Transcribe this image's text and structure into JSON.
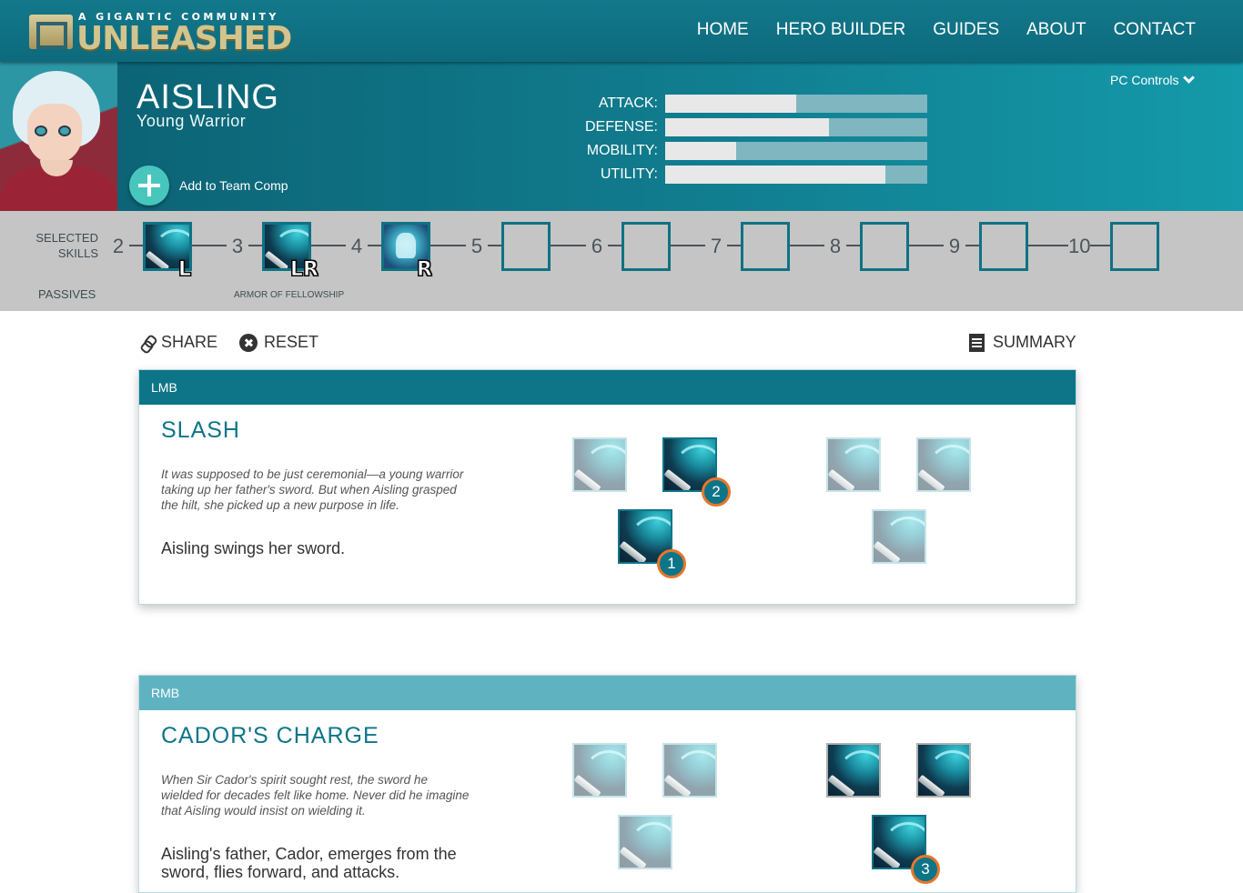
{
  "brand": {
    "tagline": "A GIGANTIC COMMUNITY",
    "name": "UNLEASHED"
  },
  "nav": {
    "items": [
      "HOME",
      "HERO BUILDER",
      "GUIDES",
      "ABOUT",
      "CONTACT"
    ]
  },
  "hero": {
    "name": "AISLING",
    "subtitle": "Young Warrior",
    "add_label": "Add to Team Comp",
    "controls_label": "PC Controls",
    "stats": [
      {
        "label": "ATTACK:",
        "value": 0.5
      },
      {
        "label": "DEFENSE:",
        "value": 0.625
      },
      {
        "label": "MOBILITY:",
        "value": 0.27
      },
      {
        "label": "UTILITY:",
        "value": 0.84
      }
    ]
  },
  "timeline": {
    "selected_label_1": "SELECTED",
    "selected_label_2": "SKILLS",
    "passives_label": "PASSIVES",
    "levels": [
      "2",
      "3",
      "4",
      "5",
      "6",
      "7",
      "8",
      "9",
      "10"
    ],
    "slots": [
      {
        "level": "2",
        "icon": "sword-slash-icon",
        "badge": "L"
      },
      {
        "level": "3",
        "icon": "sword-slash-icon",
        "badge": "LR"
      },
      {
        "level": "4",
        "icon": "armor-icon",
        "badge": "R"
      },
      {
        "level": "5",
        "icon": "",
        "badge": ""
      },
      {
        "level": "6",
        "icon": "",
        "badge": ""
      },
      {
        "level": "7",
        "icon": "",
        "badge": ""
      },
      {
        "level": "8",
        "icon": "",
        "badge": ""
      },
      {
        "level": "9",
        "icon": "",
        "badge": ""
      },
      {
        "level": "10",
        "icon": "",
        "badge": ""
      }
    ],
    "passive_name": "ARMOR OF FELLOWSHIP"
  },
  "toolbar": {
    "share": "SHARE",
    "reset": "RESET",
    "summary": "SUMMARY"
  },
  "skills": [
    {
      "key": "LMB",
      "title": "SLASH",
      "flavor": "It was supposed to be just ceremonial—a young warrior taking up her father's sword. But when Aisling grasped the hilt, she picked up a new purpose in life.",
      "description": "Aisling swings her sword.",
      "upgrades": [
        {
          "state": "dim",
          "order": ""
        },
        {
          "state": "selected",
          "order": "2"
        },
        {
          "state": "dim",
          "order": ""
        },
        {
          "state": "dim",
          "order": ""
        },
        {
          "state": "selected",
          "order": "1"
        },
        {
          "state": "dim",
          "order": ""
        }
      ]
    },
    {
      "key": "RMB",
      "title": "CADOR'S CHARGE",
      "flavor": "When Sir Cador's spirit sought rest, the sword he wielded for decades felt like home. Never did he imagine that Aisling would insist on wielding it.",
      "description": "Aisling's father, Cador, emerges from the sword, flies forward, and attacks.",
      "upgrades": [
        {
          "state": "dim",
          "order": ""
        },
        {
          "state": "dim",
          "order": ""
        },
        {
          "state": "available",
          "order": ""
        },
        {
          "state": "available",
          "order": ""
        },
        {
          "state": "dim",
          "order": ""
        },
        {
          "state": "selected",
          "order": "3"
        }
      ]
    }
  ],
  "colors": {
    "primary": "#0e7589",
    "accent_orange": "#e8762a",
    "timeline_bg": "#c5c5c5",
    "add_button": "#48c6bd"
  }
}
